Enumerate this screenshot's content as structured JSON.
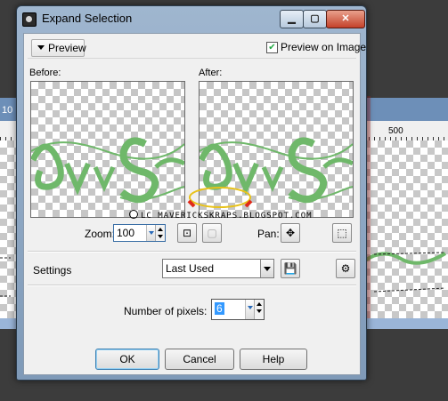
{
  "window": {
    "title": "Expand Selection",
    "controls": [
      "minimize",
      "maximize",
      "close"
    ]
  },
  "preview": {
    "toggle_label": "Preview",
    "preview_on_image_label": "Preview on Image",
    "preview_on_image_checked": true,
    "before_label": "Before:",
    "after_label": "After:",
    "zoom_label": "Zoom:",
    "zoom_value": "100",
    "pan_label": "Pan:"
  },
  "watermark": "LC MAVERICKSKRAPS.BLOGSPOT.COM",
  "settings": {
    "label": "Settings",
    "preset_value": "Last Used"
  },
  "options": {
    "pixels_label": "Number of pixels:",
    "pixels_value": "6"
  },
  "buttons": {
    "ok": "OK",
    "cancel": "Cancel",
    "help": "Help"
  },
  "background": {
    "ruler_left_number": "10",
    "ruler_right_number": "500"
  },
  "colors": {
    "artwork_green": "#6fb86a",
    "highlight_yellow": "#e8c21a",
    "highlight_red": "#e02a1a",
    "selection_blue": "#3399ff"
  },
  "icons": {
    "fit-window": "fit-window-icon",
    "actual-size": "actual-size-icon",
    "pan": "pan-icon",
    "marquee": "marquee-icon",
    "save-preset": "save-preset-icon",
    "preset-options": "preset-options-icon"
  }
}
